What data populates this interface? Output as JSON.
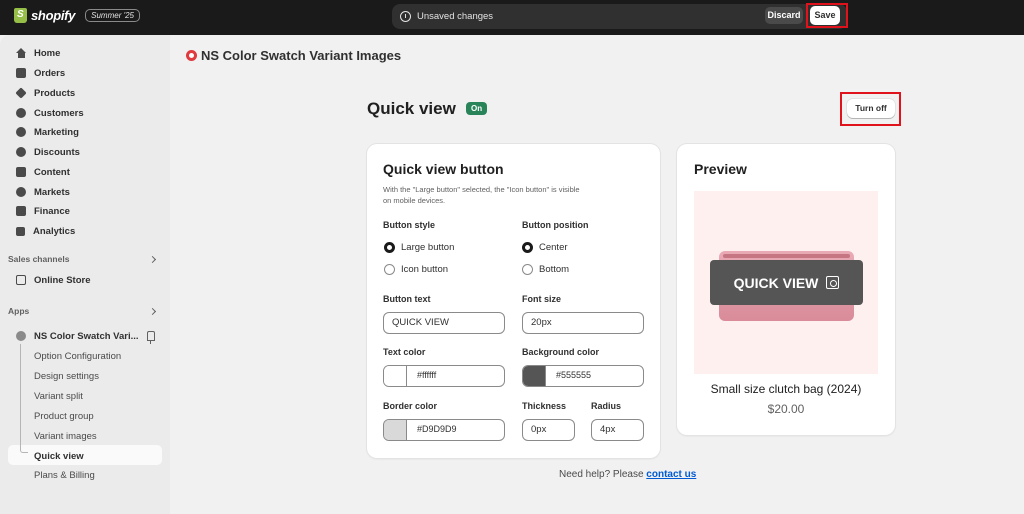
{
  "topbar": {
    "brand": "shopify",
    "edition": "Summer '25",
    "unsaved_text": "Unsaved changes",
    "discard_label": "Discard",
    "save_label": "Save"
  },
  "sidebar": {
    "items": [
      "Home",
      "Orders",
      "Products",
      "Customers",
      "Marketing",
      "Discounts",
      "Content",
      "Markets",
      "Finance",
      "Analytics"
    ],
    "sales_channels_label": "Sales channels",
    "online_store": "Online Store",
    "apps_label": "Apps",
    "app_name": "NS Color Swatch Vari...",
    "app_subitems": [
      "Option Configuration",
      "Design settings",
      "Variant split",
      "Product group",
      "Variant images",
      "Quick view",
      "Plans & Billing"
    ],
    "active_subitem": "Quick view"
  },
  "page": {
    "title": "NS Color Swatch Variant Images",
    "section_title": "Quick view",
    "status_badge": "On",
    "turn_off_label": "Turn off"
  },
  "settings": {
    "card_title": "Quick view button",
    "description": "With the \"Large button\" selected, the \"Icon button\" is visible on mobile devices.",
    "button_style_label": "Button style",
    "button_style_options": [
      "Large button",
      "Icon button"
    ],
    "button_style_selected": "Large button",
    "button_position_label": "Button position",
    "button_position_options": [
      "Center",
      "Bottom"
    ],
    "button_position_selected": "Center",
    "button_text_label": "Button text",
    "button_text_value": "QUICK VIEW",
    "font_size_label": "Font size",
    "font_size_value": "20px",
    "text_color_label": "Text color",
    "text_color_value": "#ffffff",
    "background_color_label": "Background color",
    "background_color_value": "#555555",
    "border_color_label": "Border color",
    "border_color_value": "#D9D9D9",
    "thickness_label": "Thickness",
    "thickness_value": "0px",
    "radius_label": "Radius",
    "radius_value": "4px"
  },
  "preview": {
    "title": "Preview",
    "button_text": "QUICK VIEW",
    "product_name": "Small size clutch bag (2024)",
    "product_price": "$20.00"
  },
  "footer": {
    "help_text": "Need help? Please",
    "contact_link": "contact us"
  },
  "colors": {
    "topbar_bg": "#1a1a1a",
    "badge_on": "#29845a",
    "highlight": "#e0131c",
    "link": "#005bd3"
  }
}
